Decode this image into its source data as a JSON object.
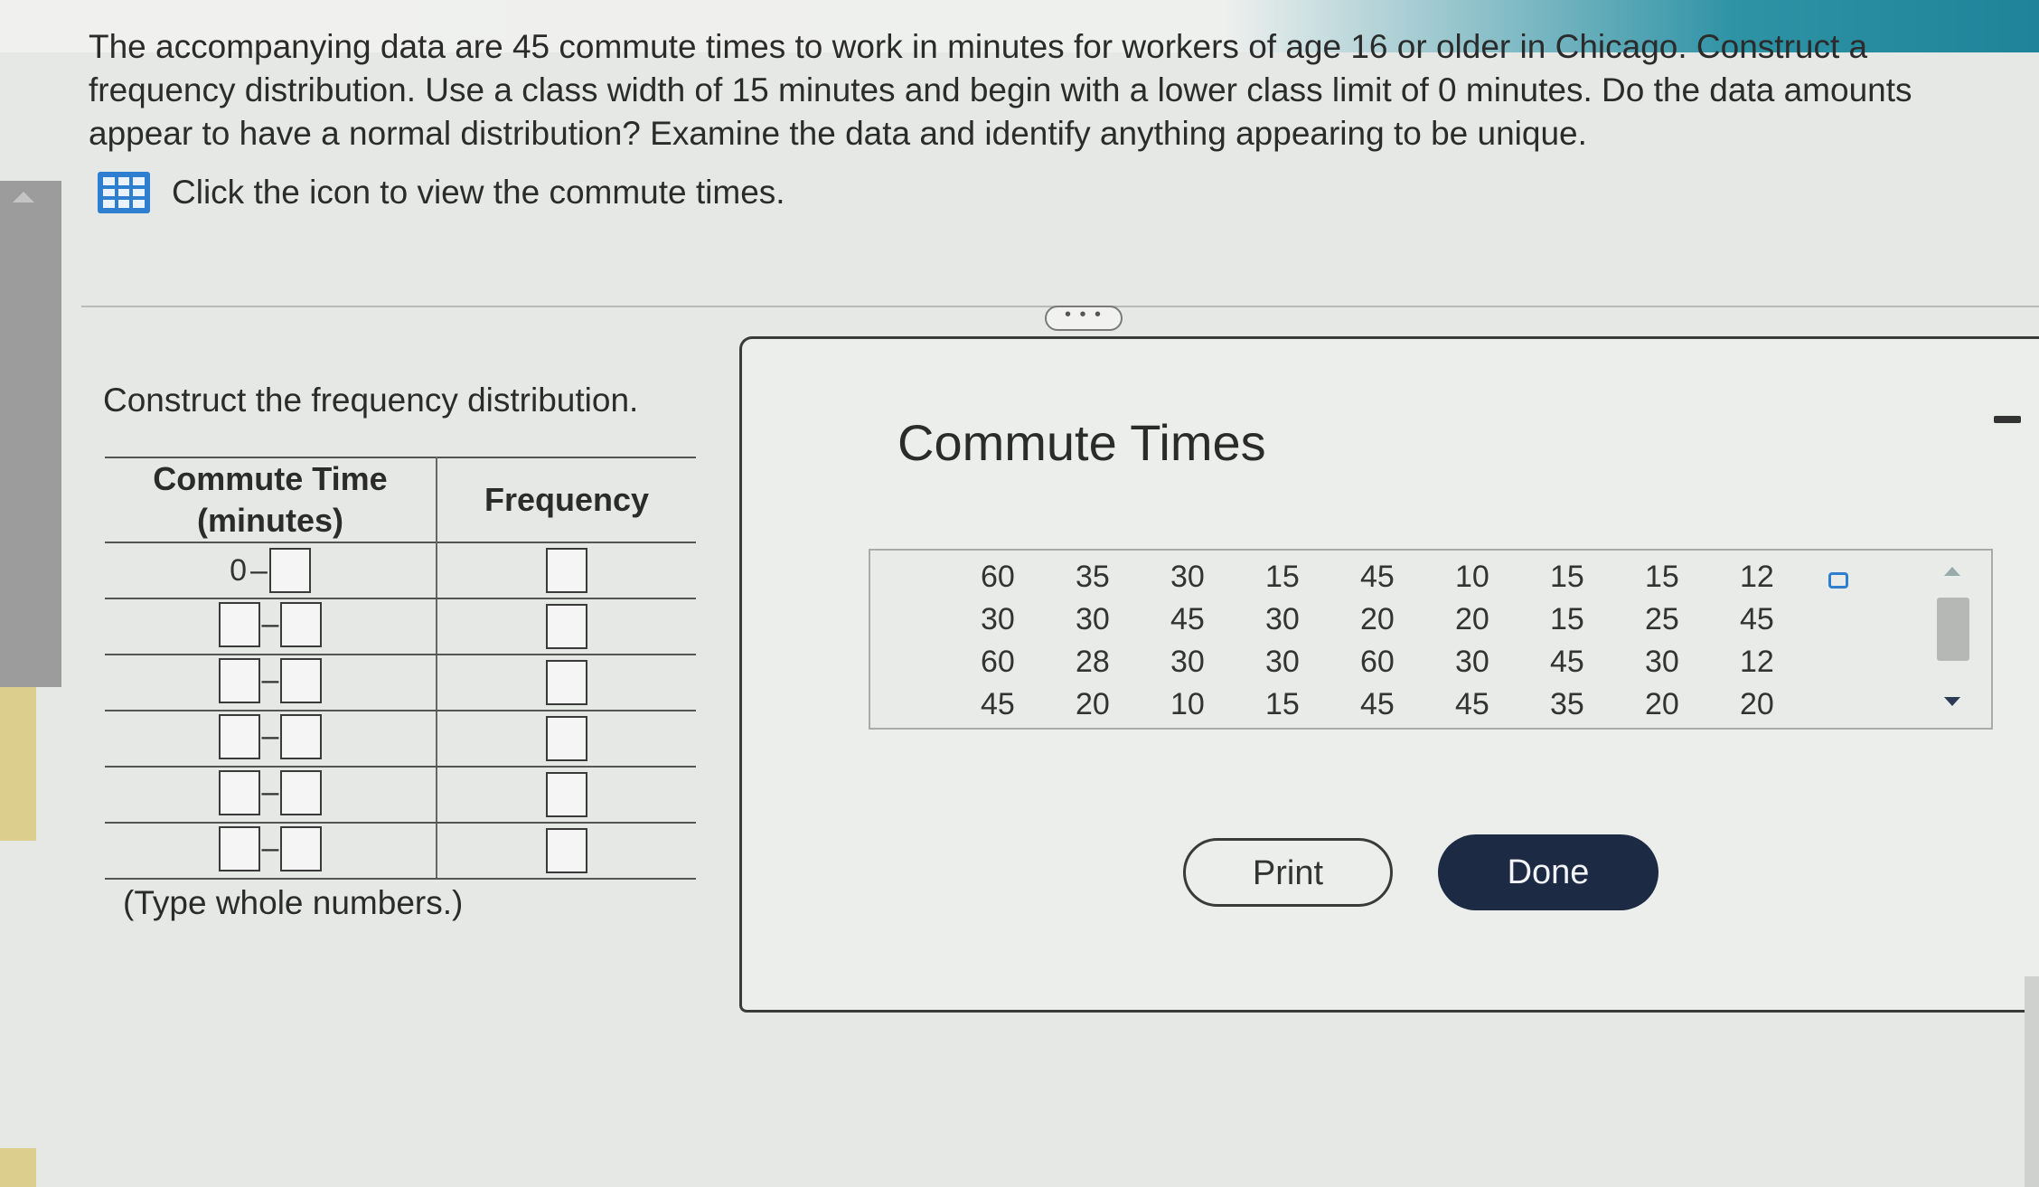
{
  "question": {
    "text": "The accompanying data are 45 commute times to work in minutes for workers of age 16 or older in Chicago. Construct a frequency distribution. Use a class width of 15 minutes and begin with a lower class limit of 0 minutes. Do the data amounts appear to have a normal distribution? Examine the data and identify anything appearing to be unique.",
    "hint_icon": "data-table-grid-icon",
    "hint_text": "Click the icon to view the commute times."
  },
  "expander_label": "• • •",
  "answer": {
    "label": "Construct the frequency distribution.",
    "table": {
      "col1_header": "Commute Time (minutes)",
      "col2_header": "Frequency",
      "first_lower_limit": "0",
      "rows": 6
    },
    "note": "(Type whole numbers.)"
  },
  "dialog": {
    "title": "Commute Times",
    "data_rows": [
      [
        "60",
        "35",
        "30",
        "15",
        "45",
        "10",
        "15",
        "15",
        "12"
      ],
      [
        "30",
        "30",
        "45",
        "30",
        "20",
        "20",
        "15",
        "25",
        "45"
      ],
      [
        "60",
        "28",
        "30",
        "30",
        "60",
        "30",
        "45",
        "30",
        "12"
      ],
      [
        "45",
        "20",
        "10",
        "15",
        "45",
        "45",
        "35",
        "20",
        "20"
      ]
    ],
    "copy_icon": "copy-icon",
    "print_label": "Print",
    "done_label": "Done"
  },
  "colors": {
    "accent_blue": "#2f7fd0",
    "done_button": "#1c2a44"
  }
}
